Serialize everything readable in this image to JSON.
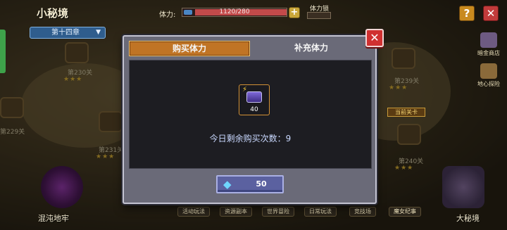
{
  "header": {
    "region_title": "小秘境",
    "chapter": "第十四章",
    "stamina_label": "体力:",
    "stamina_value": "1120/280",
    "stamina_fill_fraction": 1.0,
    "lock_label": "体力锁"
  },
  "map": {
    "stages": [
      "第230关",
      "第229关",
      "第231关",
      "第239关",
      "第240关"
    ],
    "current_tag": "当前关卡"
  },
  "side_menu": {
    "shop": "暗金商店",
    "explore": "地心探险"
  },
  "bottom_bar": {
    "left_label": "混沌地牢",
    "right_label": "大秘境",
    "buttons": [
      "活动玩法",
      "资源副本",
      "世界冒险",
      "日常玩法",
      "竞技场",
      "魔女纪事"
    ]
  },
  "dialog": {
    "tabs": [
      {
        "label": "购买体力",
        "active": true
      },
      {
        "label": "补充体力",
        "active": false
      }
    ],
    "item_quantity": "40",
    "remaining_text": "今日剩余购买次数：9",
    "price": "50",
    "close_symbol": "✕"
  },
  "colors": {
    "tab_active": "#c07425",
    "buy_button": "#5b61a0",
    "close_button": "#d03030"
  }
}
